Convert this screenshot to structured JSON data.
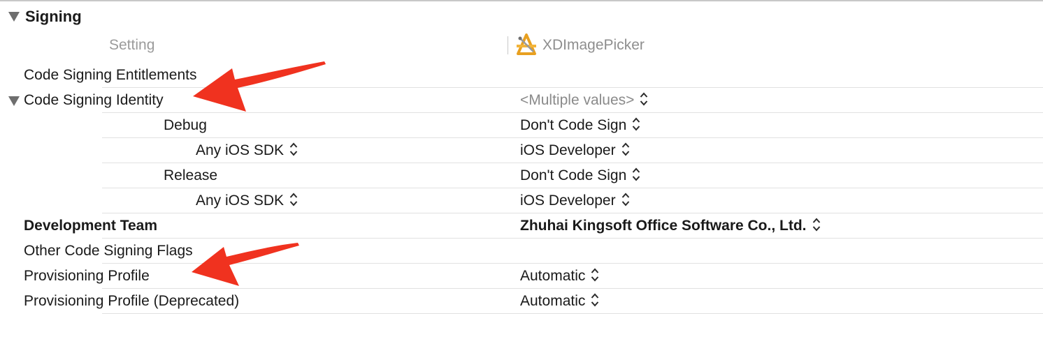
{
  "section": {
    "title": "Signing"
  },
  "columns": {
    "setting": "Setting",
    "target": "XDImagePicker"
  },
  "rows": [
    {
      "label": "Code Signing Entitlements",
      "value": ""
    },
    {
      "label": "Code Signing Identity",
      "value": "<Multiple values>"
    },
    {
      "label": "Debug",
      "value": "Don't Code Sign"
    },
    {
      "label": "Any iOS SDK",
      "value": "iOS Developer"
    },
    {
      "label": "Release",
      "value": "Don't Code Sign"
    },
    {
      "label": "Any iOS SDK",
      "value": "iOS Developer"
    },
    {
      "label": "Development Team",
      "value": "Zhuhai Kingsoft Office Software Co., Ltd."
    },
    {
      "label": "Other Code Signing Flags",
      "value": ""
    },
    {
      "label": "Provisioning Profile",
      "value": "Automatic"
    },
    {
      "label": "Provisioning Profile (Deprecated)",
      "value": "Automatic"
    }
  ],
  "colors": {
    "annotation_arrow": "#f0321f",
    "muted_text": "#8a8a8a",
    "separator": "#e1e1e1"
  },
  "icons": [
    "disclosure-triangle-icon",
    "xcode-app-icon",
    "stepper-icon"
  ]
}
